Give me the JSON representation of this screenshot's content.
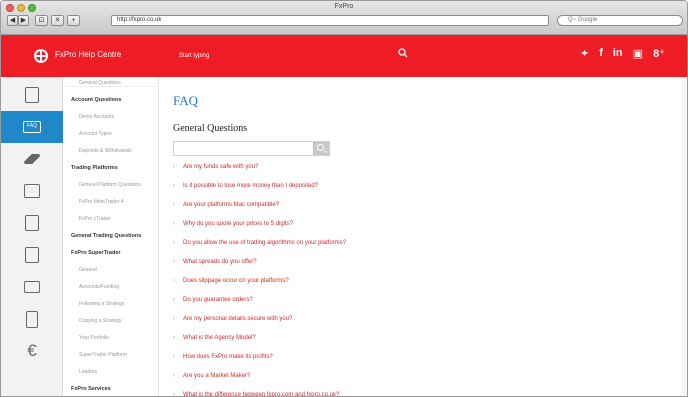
{
  "window": {
    "title": "FxPro",
    "nav_buttons": [
      "◀",
      "▶",
      "⊡",
      "✕",
      "+"
    ],
    "url": "http://fxpro.co.uk",
    "search_placeholder": "Q~ Google"
  },
  "colors": {
    "brand_red": "#ee1c25",
    "accent_blue": "#1e88c8",
    "question_red": "#d12a2a"
  },
  "topbar": {
    "brand": "FxPro Help Centre",
    "search_placeholder": "Start typing",
    "social": [
      "twitter-icon",
      "facebook-icon",
      "linkedin-icon",
      "youtube-icon",
      "googleplus-icon"
    ],
    "social_glyphs": [
      "✦",
      "f",
      "in",
      "▣",
      "8⁺"
    ]
  },
  "leftbar": [
    {
      "name": "help-icon",
      "active": false
    },
    {
      "name": "faq-icon",
      "active": true,
      "label": "FAQ"
    },
    {
      "name": "education-icon",
      "active": false
    },
    {
      "name": "platforms-icon",
      "active": false
    },
    {
      "name": "document-icon",
      "active": false
    },
    {
      "name": "forms-icon",
      "active": false
    },
    {
      "name": "video-icon",
      "active": false
    },
    {
      "name": "calendar-icon",
      "active": false
    },
    {
      "name": "cash-icon",
      "active": false
    }
  ],
  "subnav": [
    {
      "label": "General Questions",
      "style": "sub"
    },
    {
      "label": "Account Questions",
      "style": "bold"
    },
    {
      "label": "Demo Accounts",
      "style": "sub"
    },
    {
      "label": "Account Types",
      "style": "sub"
    },
    {
      "label": "Deposits & Withdrawals",
      "style": "sub"
    },
    {
      "label": "Trading Platforms",
      "style": "bold"
    },
    {
      "label": "General Platform Questions",
      "style": "sub"
    },
    {
      "label": "FxPro MetaTrader 4",
      "style": "sub"
    },
    {
      "label": "FxPro cTrader",
      "style": "sub"
    },
    {
      "label": "General Trading Questions",
      "style": "bold"
    },
    {
      "label": "FxPro SuperTrader",
      "style": "bold"
    },
    {
      "label": "General",
      "style": "sub"
    },
    {
      "label": "Accounts/Funding",
      "style": "sub"
    },
    {
      "label": "Following a Strategy",
      "style": "sub"
    },
    {
      "label": "Copying a Strategy",
      "style": "sub"
    },
    {
      "label": "Your Portfolio",
      "style": "sub"
    },
    {
      "label": "SuperTrader Platform",
      "style": "sub"
    },
    {
      "label": "Leaders",
      "style": "sub"
    },
    {
      "label": "FxPro Services",
      "style": "bold"
    }
  ],
  "content": {
    "title": "FAQ",
    "section": "General Questions",
    "questions": [
      "Are my funds safe with you?",
      "Is it possible to lose more money than I deposited?",
      "Are your platforms Mac compatible?",
      "Why do you quote your prices to 5 digits?",
      "Do you allow the use of trading algorithms on your platforms?",
      "What spreads do you offer?",
      "Does slippage occur on your platforms?",
      "Do you guarantee orders?",
      "Are my personal details secure with you?",
      "What is the Agency Model?",
      "How does FxPro make its profits?",
      "Are you a Market Maker?",
      "What is the difference between fxpro.com and fxpro.co.uk?"
    ]
  }
}
